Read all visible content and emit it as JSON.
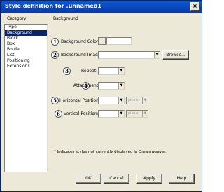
{
  "window": {
    "title": "Style definition for .unnamed1",
    "close_glyph": "×"
  },
  "category": {
    "header": "Category",
    "items": [
      "Type",
      "Background",
      "Block",
      "Box",
      "Border",
      "List",
      "Positioning",
      "Extensions"
    ],
    "selected": "Background"
  },
  "background": {
    "header": "Background",
    "step_numbers": [
      "1",
      "2",
      "3",
      "4",
      "5",
      "6"
    ],
    "color_label": "Background Color:",
    "color_value": "",
    "image_label": "Background Image:",
    "image_value": "",
    "browse_label": "Browse...",
    "repeat_label": "Repeat:",
    "repeat_value": "",
    "attachment_label": "Attachment:",
    "attachment_value": "",
    "hpos_label": "Horizontal Position:",
    "hpos_value": "",
    "hpos_unit": "pixels",
    "vpos_label": "Vertical Position:",
    "vpos_value": "",
    "vpos_unit": "pixels",
    "dropdown_arrow": "▼"
  },
  "note": "* Indicates styles not currently displayed in Dreamweaver.",
  "buttons": {
    "ok": "OK",
    "cancel": "Cancel",
    "apply": "Apply",
    "help": "Help"
  }
}
